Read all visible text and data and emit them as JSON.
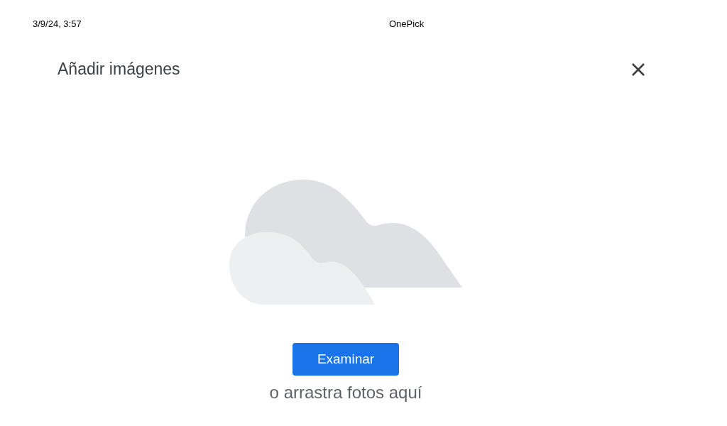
{
  "print_header": {
    "date": "3/9/24, 3:57",
    "title": "OnePick"
  },
  "dialog": {
    "title": "Añadir imágenes",
    "browse_button": "Examinar",
    "drop_hint": "o arrastra fotos aquí"
  }
}
